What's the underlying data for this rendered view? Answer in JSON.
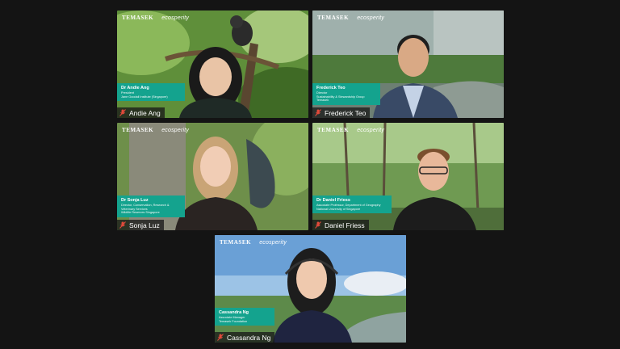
{
  "brand": {
    "temasek": "TEMASEK",
    "ecosperity": "ecosperity"
  },
  "participants": [
    {
      "display_name": "Andie Ang",
      "title_name": "Dr Andie Ang",
      "role": "President",
      "org": "Jane Goodall Institute (Singapore)",
      "muted": true
    },
    {
      "display_name": "Frederick Teo",
      "title_name": "Frederick Teo",
      "role": "Director",
      "org": "Sustainability & Stewardship Group",
      "org2": "Temasek",
      "muted": true
    },
    {
      "display_name": "Sonja Luz",
      "title_name": "Dr Sonja Luz",
      "role": "Director, Conservation, Research & Veterinary Services",
      "org": "Wildlife Reserves Singapore",
      "muted": true
    },
    {
      "display_name": "Daniel Friess",
      "title_name": "Dr Daniel Friess",
      "role": "Associate Professor, Department of Geography",
      "org": "National University of Singapore",
      "muted": true
    },
    {
      "display_name": "Cassandra Ng",
      "title_name": "Cassandra Ng",
      "role": "Associate Manager",
      "org": "Temasek Foundation",
      "muted": true
    }
  ],
  "icons": {
    "muted": "mic-muted-icon"
  },
  "colors": {
    "caption": "#14a38e",
    "background": "#141414"
  }
}
